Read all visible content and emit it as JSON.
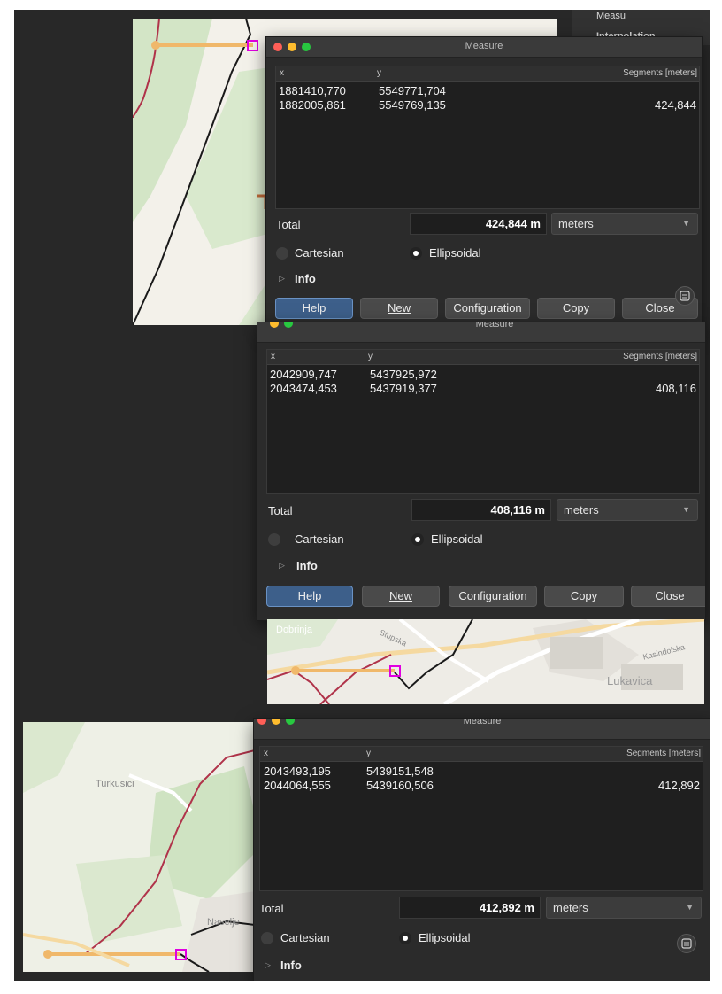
{
  "sidepanel": {
    "item1": "Measu",
    "item2": "Interpolation"
  },
  "map2": {
    "labels": {
      "a": "Dobrinja",
      "b": "Lukavica",
      "c": "Stupska",
      "d": "Kasindolska"
    }
  },
  "map3": {
    "labels": {
      "a": "Turkusici",
      "b": "Naselje"
    }
  },
  "windows": [
    {
      "title": "Measure",
      "headers": {
        "x": "x",
        "y": "y",
        "seg": "Segments [meters]"
      },
      "rows": [
        {
          "x": "1881410,770",
          "y": "5549771,704",
          "seg": ""
        },
        {
          "x": "1882005,861",
          "y": "5549769,135",
          "seg": "424,844"
        }
      ],
      "total_label": "Total",
      "total_value": "424,844 m",
      "unit": "meters",
      "cartesian": "Cartesian",
      "ellipsoidal": "Ellipsoidal",
      "info": "Info",
      "buttons": {
        "help": "Help",
        "new": "New",
        "configuration": "Configuration",
        "copy": "Copy",
        "close": "Close"
      }
    },
    {
      "title": "Measure",
      "headers": {
        "x": "x",
        "y": "y",
        "seg": "Segments [meters]"
      },
      "rows": [
        {
          "x": "2042909,747",
          "y": "5437925,972",
          "seg": ""
        },
        {
          "x": "2043474,453",
          "y": "5437919,377",
          "seg": "408,116"
        }
      ],
      "total_label": "Total",
      "total_value": "408,116 m",
      "unit": "meters",
      "cartesian": "Cartesian",
      "ellipsoidal": "Ellipsoidal",
      "info": "Info",
      "buttons": {
        "help": "Help",
        "new": "New",
        "configuration": "Configuration",
        "copy": "Copy",
        "close": "Close"
      }
    },
    {
      "title": "Measure",
      "headers": {
        "x": "x",
        "y": "y",
        "seg": "Segments [meters]"
      },
      "rows": [
        {
          "x": "2043493,195",
          "y": "5439151,548",
          "seg": ""
        },
        {
          "x": "2044064,555",
          "y": "5439160,506",
          "seg": "412,892"
        }
      ],
      "total_label": "Total",
      "total_value": "412,892 m",
      "unit": "meters",
      "cartesian": "Cartesian",
      "ellipsoidal": "Ellipsoidal",
      "info": "Info"
    }
  ],
  "colors": {
    "route_red": "#b0334a",
    "route_black": "#1a1a1a",
    "measure_line": "#f0b86a",
    "marker": "#e000e0",
    "map_green": "#cfe3c2",
    "map_bg": "#f1efe8"
  },
  "icons": {
    "float": "float-panel-icon",
    "dropdown": "chevron-down-icon",
    "disclosure": "disclosure-triangle-icon"
  }
}
